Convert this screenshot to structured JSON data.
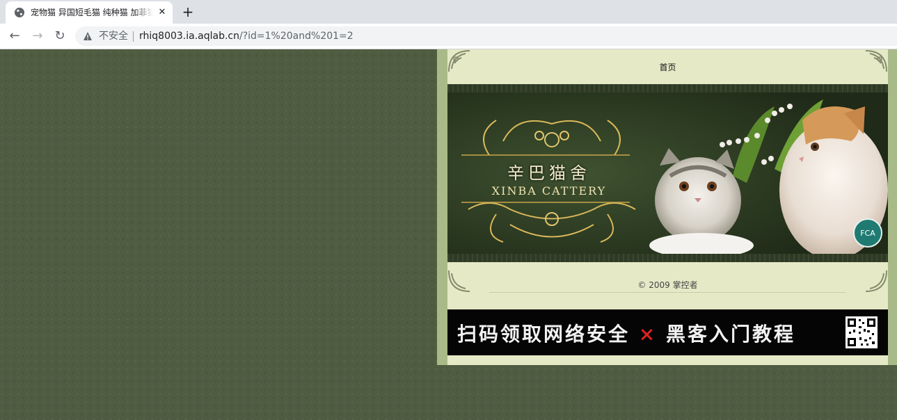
{
  "browser": {
    "tab_title": "宠物猫 异国短毛猫 纯种猫 加菲猫",
    "tab_close": "✕",
    "new_tab": "+",
    "back": "←",
    "forward": "→",
    "reload": "↻",
    "security_label": "不安全",
    "url_host": "rhiq8003.ia.aqlab.cn",
    "url_path": "/?id=1%20and%201=2"
  },
  "page": {
    "nav_home": "首页",
    "banner_title_cn": "辛巴猫舍",
    "banner_title_en": "XINBA CATTERY",
    "banner_badge": "FCA",
    "copyright": "© 2009 掌控者",
    "ad_text_left": "扫码领取网络安全",
    "ad_x": "×",
    "ad_text_right": "黑客入门教程"
  },
  "colors": {
    "background": "#4f5c41",
    "site_border": "#a9ba89",
    "content_bg": "#e5e9c6"
  }
}
